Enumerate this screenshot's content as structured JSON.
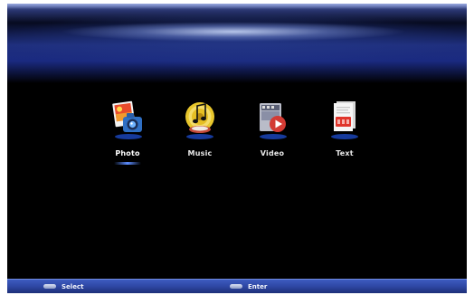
{
  "menu": {
    "items": [
      {
        "label": "Photo",
        "icon": "photo-icon",
        "selected": true
      },
      {
        "label": "Music",
        "icon": "music-icon",
        "selected": false
      },
      {
        "label": "Video",
        "icon": "video-icon",
        "selected": false
      },
      {
        "label": "Text",
        "icon": "text-icon",
        "selected": false
      }
    ]
  },
  "footer": {
    "select_label": "Select",
    "enter_label": "Enter"
  },
  "colors": {
    "background": "#000000",
    "header_blue": "#1f2f7e",
    "footer_blue": "#2e47a4",
    "selection_underline": "#5b8cff"
  }
}
